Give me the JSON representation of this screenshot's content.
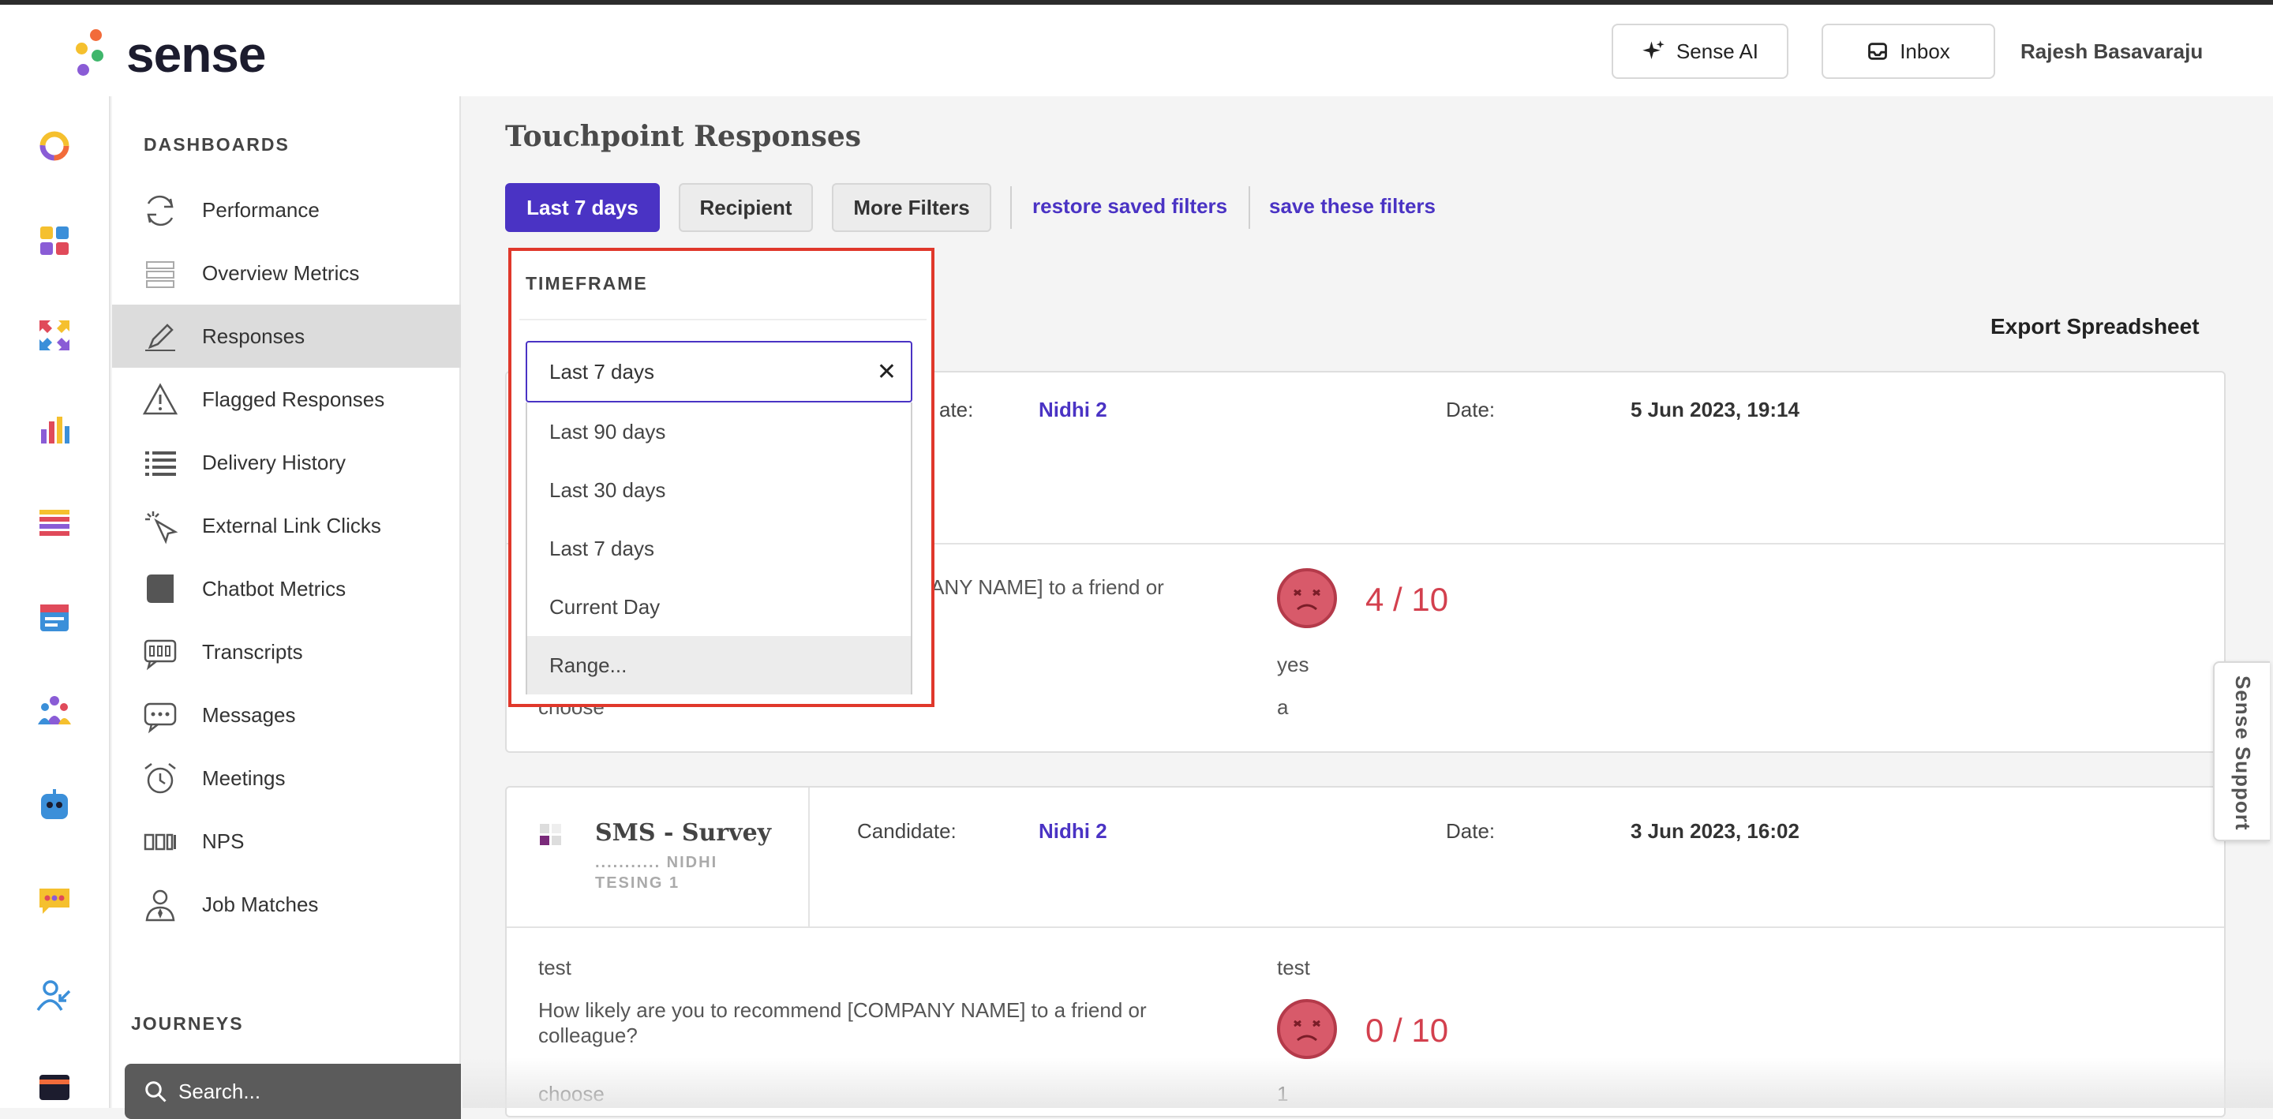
{
  "app": {
    "logo_text": "sense",
    "brand_color": "#4a33c4",
    "alert_color": "#e0382b"
  },
  "header": {
    "sense_ai_label": "Sense AI",
    "inbox_label": "Inbox",
    "user_name": "Rajesh Basavaraju"
  },
  "iconbar": {
    "icons": [
      "sense-ring-icon",
      "dashboard-grid-icon",
      "workflow-arrows-icon",
      "bar-chart-icon",
      "list-icon",
      "calendar-icon",
      "team-icon",
      "chatbot-icon",
      "chat-bubble-icon",
      "user-check-icon",
      "card-icon"
    ]
  },
  "sidebar": {
    "section_dashboards": "DASHBOARDS",
    "items": [
      {
        "label": "Performance",
        "icon": "refresh-icon"
      },
      {
        "label": "Overview Metrics",
        "icon": "stack-icon"
      },
      {
        "label": "Responses",
        "icon": "pencil-icon"
      },
      {
        "label": "Flagged Responses",
        "icon": "warning-icon"
      },
      {
        "label": "Delivery History",
        "icon": "list-icon"
      },
      {
        "label": "External Link Clicks",
        "icon": "pointer-click-icon"
      },
      {
        "label": "Chatbot Metrics",
        "icon": "chatbot-icon"
      },
      {
        "label": "Transcripts",
        "icon": "transcript-icon"
      },
      {
        "label": "Messages",
        "icon": "message-icon"
      },
      {
        "label": "Meetings",
        "icon": "alarm-clock-icon"
      },
      {
        "label": "NPS",
        "icon": "nps-icon"
      },
      {
        "label": "Job Matches",
        "icon": "person-tie-icon"
      }
    ],
    "active_index": 2,
    "section_journeys": "JOURNEYS",
    "search_placeholder": "Search..."
  },
  "main": {
    "title": "Touchpoint Responses",
    "filters": {
      "timeframe_button": "Last 7 days",
      "recipient_button": "Recipient",
      "more_filters_button": "More Filters",
      "restore_link": "restore saved filters",
      "save_link": "save these filters"
    },
    "export_label": "Export Spreadsheet",
    "cards": [
      {
        "candidate_label": "ate:",
        "candidate_value": "Nidhi 2",
        "date_label": "Date:",
        "date_value": "5 Jun 2023, 19:14",
        "question_fragment": "MPANY NAME] to a friend or",
        "score": "4 / 10",
        "answer1": "yes",
        "row3_label": "choose",
        "answer2": "a"
      },
      {
        "title": "SMS - Survey",
        "subtitle_line1": "........... NIDHI",
        "subtitle_line2": "TESING 1",
        "candidate_label": "Candidate:",
        "candidate_value": "Nidhi 2",
        "date_label": "Date:",
        "date_value": "3 Jun 2023, 16:02",
        "row1_label": "test",
        "row1_value": "test",
        "question_line1": "How likely are you to recommend [COMPANY NAME] to a friend or",
        "question_line2": "colleague?",
        "score": "0 / 10",
        "row3_label": "choose",
        "row3_value": "1"
      }
    ]
  },
  "dropdown": {
    "title": "TIMEFRAME",
    "input_value": "Last 7 days",
    "clear_symbol": "✕",
    "options": [
      "Last 90 days",
      "Last 30 days",
      "Last 7 days",
      "Current Day",
      "Range..."
    ],
    "highlighted_index": 4
  },
  "support_tab": "Sense Support"
}
